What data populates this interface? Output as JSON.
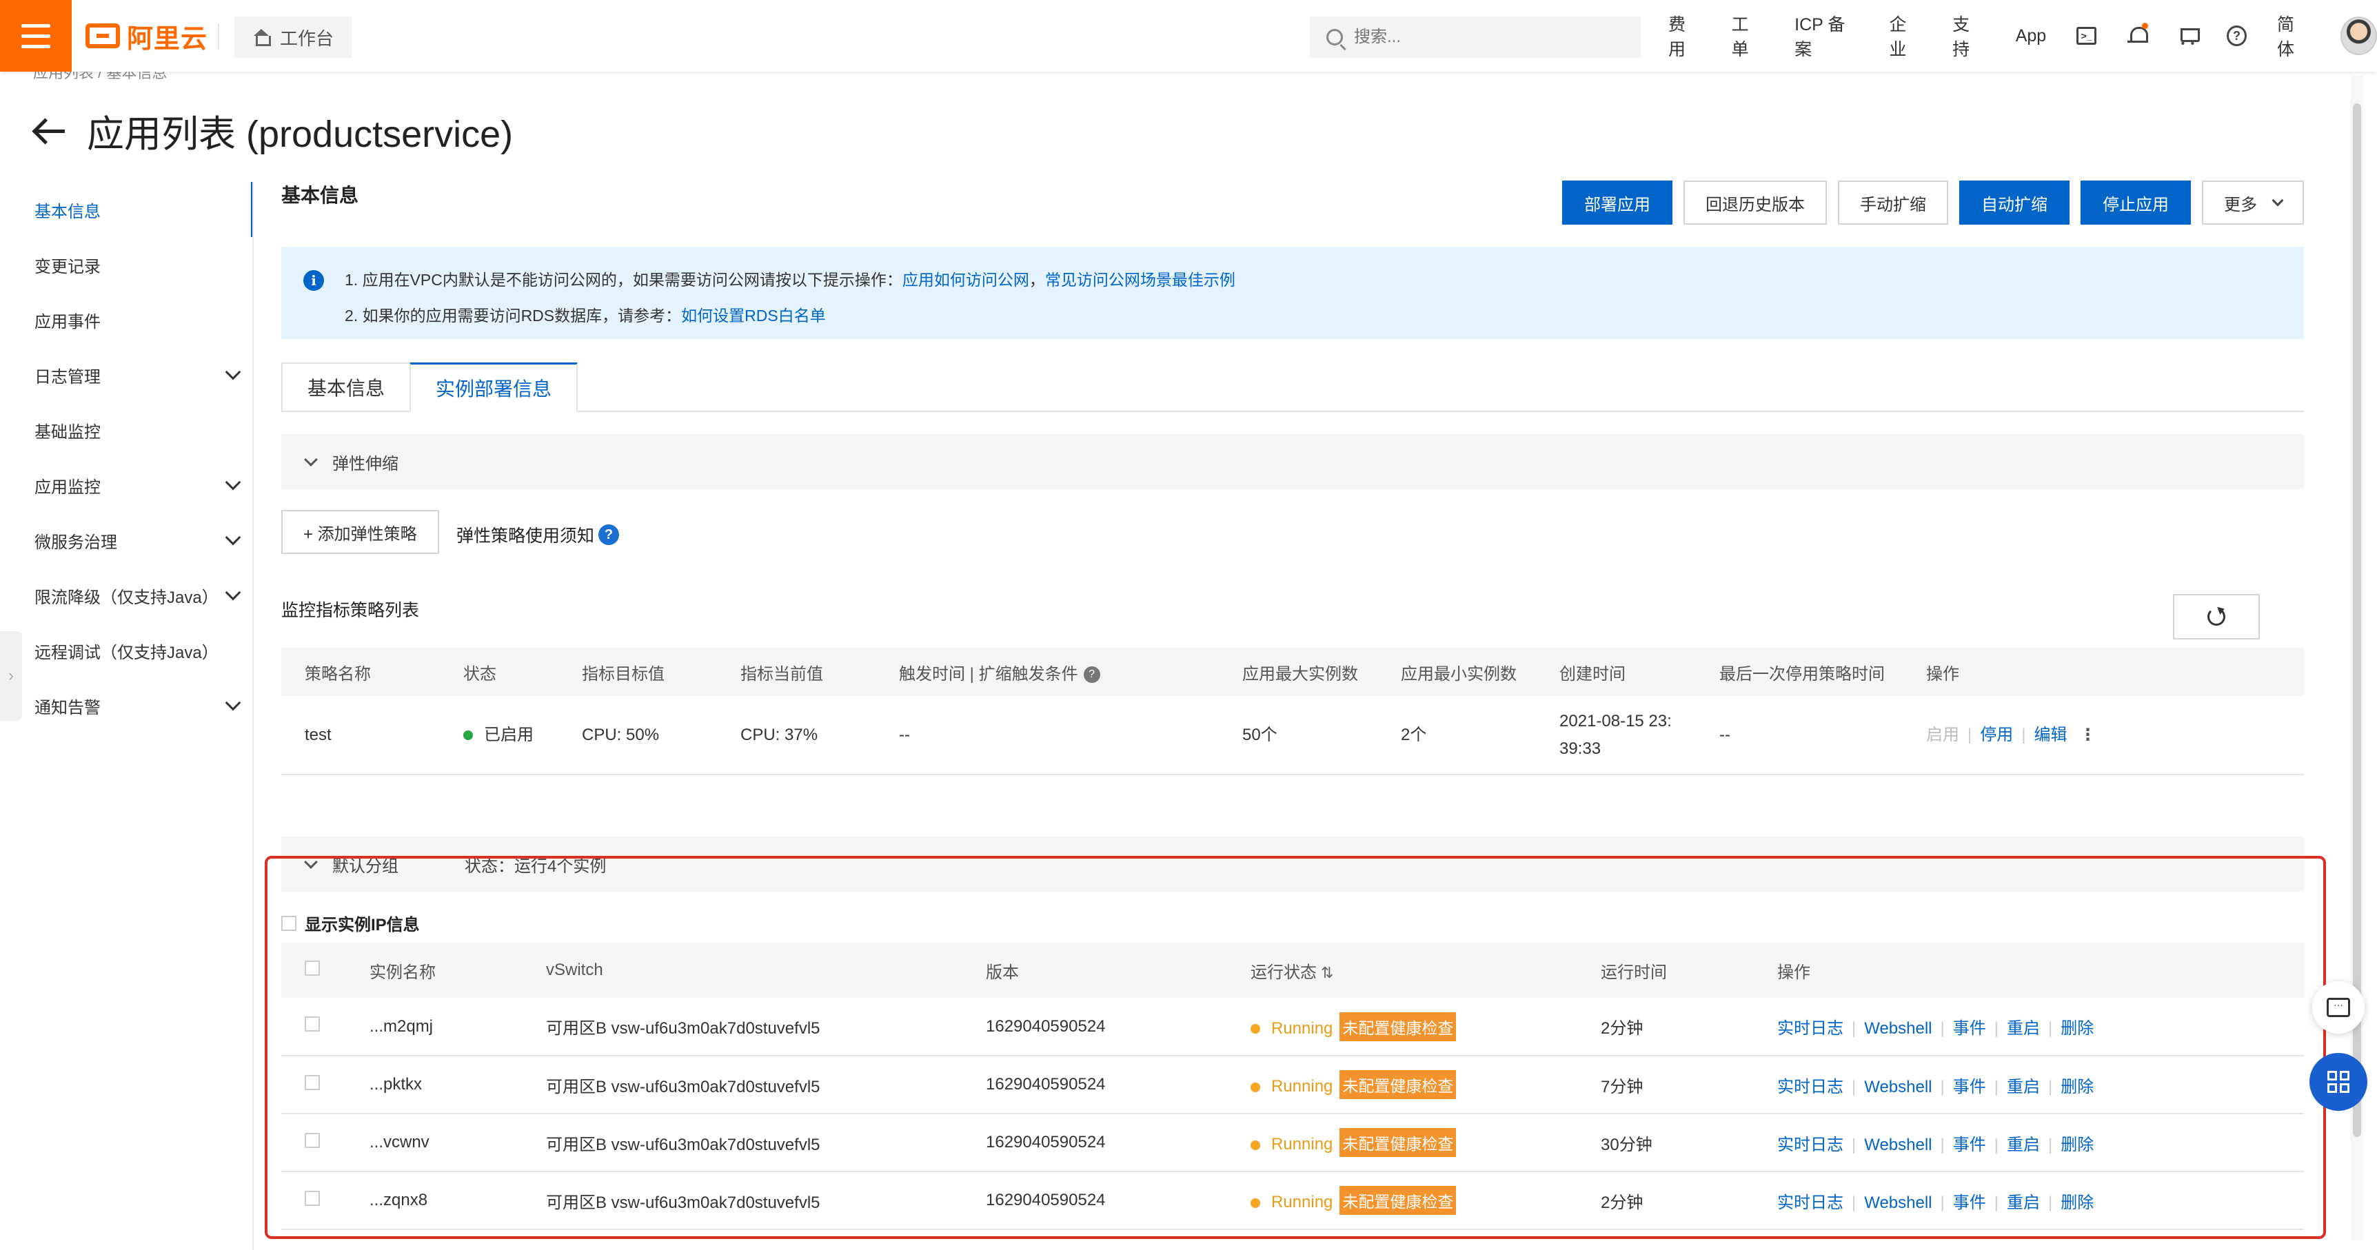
{
  "header": {
    "logo_text": "阿里云",
    "workbench_label": "工作台",
    "search_placeholder": "搜索...",
    "nav": [
      "费用",
      "工单",
      "ICP 备案",
      "企业",
      "支持",
      "App"
    ],
    "lang_label": "简体",
    "icons": [
      "terminal-icon",
      "bell-icon",
      "cart-icon",
      "help-icon"
    ],
    "accent_color": "#ff6a00"
  },
  "breadcrumb": "应用列表 / 基本信息",
  "page_title": "应用列表 (productservice)",
  "sidebar": {
    "items": [
      {
        "label": "基本信息",
        "active": true
      },
      {
        "label": "变更记录"
      },
      {
        "label": "应用事件"
      },
      {
        "label": "日志管理",
        "expandable": true
      },
      {
        "label": "基础监控"
      },
      {
        "label": "应用监控",
        "expandable": true
      },
      {
        "label": "微服务治理",
        "expandable": true
      },
      {
        "label": "限流降级（仅支持Java）",
        "expandable": true
      },
      {
        "label": "远程调试（仅支持Java）"
      },
      {
        "label": "通知告警",
        "expandable": true
      }
    ]
  },
  "main": {
    "section_title": "基本信息",
    "actions": {
      "deploy": "部署应用",
      "rollback": "回退历史版本",
      "manual_scale": "手动扩缩",
      "auto_scale": "自动扩缩",
      "stop": "停止应用",
      "more": "更多"
    },
    "notice": {
      "line1_text": "1. 应用在VPC内默认是不能访问公网的，如果需要访问公网请按以下提示操作：",
      "line1_link1": "应用如何访问公网",
      "line1_sep": "，",
      "line1_link2": "常见访问公网场景最佳示例",
      "line2_text": "2. 如果你的应用需要访问RDS数据库，请参考：",
      "line2_link": "如何设置RDS白名单"
    },
    "tabs": [
      "基本信息",
      "实例部署信息"
    ],
    "active_tab": 1,
    "elastic": {
      "title": "弹性伸缩",
      "add_button": "+ 添加弹性策略",
      "policy_note": "弹性策略使用须知",
      "list_title": "监控指标策略列表",
      "columns": [
        "策略名称",
        "状态",
        "指标目标值",
        "指标当前值",
        "触发时间 | 扩缩触发条件",
        "应用最大实例数",
        "应用最小实例数",
        "创建时间",
        "最后一次停用策略时间",
        "操作"
      ],
      "rows": [
        {
          "name": "test",
          "status": "已启用",
          "target": "CPU: 50%",
          "current": "CPU: 37%",
          "trigger": "--",
          "max": "50个",
          "min": "2个",
          "created_line1": "2021-08-15 23:",
          "created_line2": "39:33",
          "last_disabled": "--",
          "op_enable": "启用",
          "op_disable": "停用",
          "op_edit": "编辑"
        }
      ]
    },
    "group": {
      "title": "默认分组",
      "state": "状态：运行4个实例",
      "show_ip_label": "显示实例IP信息",
      "columns": [
        "实例名称",
        "vSwitch",
        "版本",
        "运行状态",
        "运行时间",
        "操作"
      ],
      "ops": [
        "实时日志",
        "Webshell",
        "事件",
        "重启",
        "删除"
      ],
      "rows": [
        {
          "name": "...m2qmj",
          "vswitch": "可用区B vsw-uf6u3m0ak7d0stuvefvl5",
          "version": "1629040590524",
          "status": "Running",
          "health": "未配置健康检查",
          "uptime": "2分钟"
        },
        {
          "name": "...pktkx",
          "vswitch": "可用区B vsw-uf6u3m0ak7d0stuvefvl5",
          "version": "1629040590524",
          "status": "Running",
          "health": "未配置健康检查",
          "uptime": "7分钟"
        },
        {
          "name": "...vcwnv",
          "vswitch": "可用区B vsw-uf6u3m0ak7d0stuvefvl5",
          "version": "1629040590524",
          "status": "Running",
          "health": "未配置健康检查",
          "uptime": "30分钟"
        },
        {
          "name": "...zqnx8",
          "vswitch": "可用区B vsw-uf6u3m0ak7d0stuvefvl5",
          "version": "1629040590524",
          "status": "Running",
          "health": "未配置健康检查",
          "uptime": "2分钟"
        }
      ]
    }
  },
  "colors": {
    "primary": "#0064c8",
    "running": "#e89d17",
    "health_badge": "#f5922b",
    "highlight": "#d93026"
  }
}
